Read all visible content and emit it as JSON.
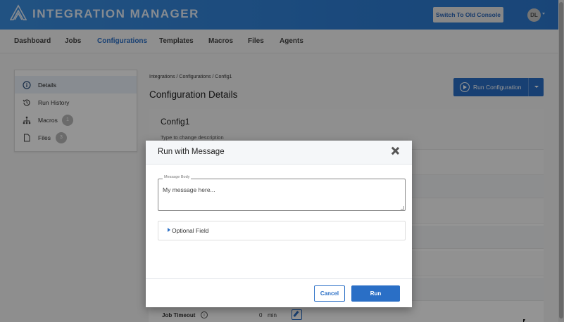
{
  "app": {
    "title": "INTEGRATION MANAGER",
    "switch_label": "Switch To Old Console",
    "avatar_initials": "DL",
    "colors": {
      "primary": "#2a6fc6",
      "header": "#2f7fd6",
      "overlay": "rgba(0,0,0,0.42)"
    }
  },
  "nav": {
    "items": [
      {
        "label": "Dashboard"
      },
      {
        "label": "Jobs"
      },
      {
        "label": "Configurations"
      },
      {
        "label": "Templates"
      },
      {
        "label": "Macros"
      },
      {
        "label": "Files"
      },
      {
        "label": "Agents"
      }
    ],
    "active": "Configurations"
  },
  "sidebar": {
    "items": [
      {
        "label": "Details",
        "icon": "info-icon"
      },
      {
        "label": "Run History",
        "icon": "history-icon"
      },
      {
        "label": "Macros",
        "icon": "macros-icon",
        "badge": "1"
      },
      {
        "label": "Files",
        "icon": "file-icon",
        "badge": "3"
      }
    ],
    "active": "Details"
  },
  "main": {
    "breadcrumb": "Integrations / Configurations / Config1",
    "title": "Configuration Details",
    "run_label": "Run Configuration",
    "config_name": "Config1",
    "description_placeholder": "Type to change description",
    "job_timeout_label": "Job Timeout",
    "job_timeout_value": "0",
    "job_timeout_unit": "min"
  },
  "modal": {
    "title": "Run with Message",
    "message_label": "Message Body",
    "message_placeholder": "My message here...",
    "optional_label": "Optional Field",
    "cancel_label": "Cancel",
    "run_label": "Run"
  }
}
